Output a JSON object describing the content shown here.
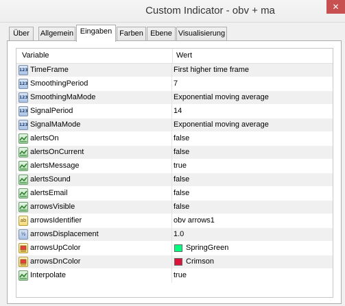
{
  "window": {
    "title": "Custom Indicator - obv + ma",
    "close_glyph": "✕"
  },
  "tabs": [
    {
      "label": "Über",
      "active": false
    },
    {
      "label": "Allgemein",
      "active": false
    },
    {
      "label": "Eingaben",
      "active": true
    },
    {
      "label": "Farben",
      "active": false
    },
    {
      "label": "Ebene",
      "active": false
    },
    {
      "label": "Visualisierung",
      "active": false
    }
  ],
  "grid": {
    "columns": {
      "variable": "Variable",
      "value": "Wert"
    },
    "rows": [
      {
        "name": "TimeFrame",
        "value": "First higher time frame",
        "type": "int",
        "icon": "int-icon"
      },
      {
        "name": "SmoothingPeriod",
        "value": "7",
        "type": "int",
        "icon": "int-icon"
      },
      {
        "name": "SmoothingMaMode",
        "value": "Exponential moving average",
        "type": "int",
        "icon": "int-icon"
      },
      {
        "name": "SignalPeriod",
        "value": "14",
        "type": "int",
        "icon": "int-icon"
      },
      {
        "name": "SignalMaMode",
        "value": "Exponential moving average",
        "type": "int",
        "icon": "int-icon"
      },
      {
        "name": "alertsOn",
        "value": "false",
        "type": "bool",
        "icon": "bool-icon"
      },
      {
        "name": "alertsOnCurrent",
        "value": "false",
        "type": "bool",
        "icon": "bool-icon"
      },
      {
        "name": "alertsMessage",
        "value": "true",
        "type": "bool",
        "icon": "bool-icon"
      },
      {
        "name": "alertsSound",
        "value": "false",
        "type": "bool",
        "icon": "bool-icon"
      },
      {
        "name": "alertsEmail",
        "value": "false",
        "type": "bool",
        "icon": "bool-icon"
      },
      {
        "name": "arrowsVisible",
        "value": "false",
        "type": "bool",
        "icon": "bool-icon"
      },
      {
        "name": "arrowsIdentifier",
        "value": "obv arrows1",
        "type": "string",
        "icon": "string-icon",
        "icon_text": "ab"
      },
      {
        "name": "arrowsDisplacement",
        "value": "1.0",
        "type": "double",
        "icon": "double-icon",
        "icon_text": "½"
      },
      {
        "name": "arrowsUpColor",
        "value": "SpringGreen",
        "type": "color",
        "icon": "color-icon",
        "swatch": "#00ff7f"
      },
      {
        "name": "arrowsDnColor",
        "value": "Crimson",
        "type": "color",
        "icon": "color-icon",
        "swatch": "#dc143c"
      },
      {
        "name": "Interpolate",
        "value": "true",
        "type": "bool",
        "icon": "bool-icon"
      }
    ]
  }
}
